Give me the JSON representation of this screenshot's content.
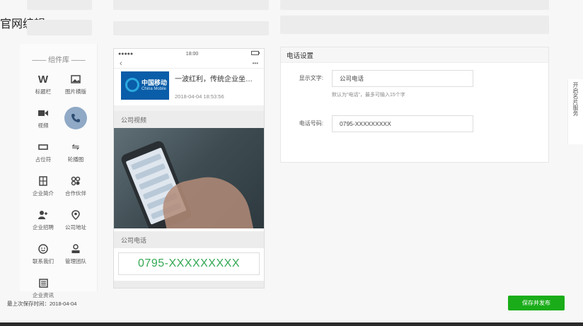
{
  "page": {
    "title": "官网编辑"
  },
  "library": {
    "title": "—— 组件库 ——",
    "items": [
      {
        "label": "标题栏",
        "icon": "title-bar-icon"
      },
      {
        "label": "图片横版",
        "icon": "image-landscape-icon"
      },
      {
        "label": "视频",
        "icon": "video-icon"
      },
      {
        "label": "",
        "icon": "phone-icon",
        "active": true
      },
      {
        "label": "占位符",
        "icon": "placeholder-icon"
      },
      {
        "label": "轮播图",
        "icon": "carousel-icon"
      },
      {
        "label": "企业简介",
        "icon": "company-intro-icon"
      },
      {
        "label": "合作伙伴",
        "icon": "partners-icon"
      },
      {
        "label": "企业招聘",
        "icon": "recruitment-icon"
      },
      {
        "label": "公司地址",
        "icon": "location-icon"
      },
      {
        "label": "联系我们",
        "icon": "contact-icon"
      },
      {
        "label": "管理团队",
        "icon": "team-icon"
      },
      {
        "label": "企业资讯",
        "icon": "news-icon"
      }
    ]
  },
  "phone": {
    "status_carrier": "●●●●●",
    "status_time": "18:00",
    "nav_back": "‹",
    "nav_more": "•••",
    "news": {
      "logo_cn": "中国移动",
      "logo_en": "China Mobile",
      "title": "一波红利，传统企业坐不...",
      "time": "2018-04-04 18:53:56"
    },
    "video_section_title": "公司视频",
    "phone_section_title": "公司电话",
    "phone_number": "0795-XXXXXXXXX"
  },
  "settings": {
    "title": "电话设置",
    "display_text_label": "显示文字:",
    "display_text_value": "公司电话",
    "display_text_hint": "默认为\"电话\"，最多可输入15个字",
    "phone_label": "电话号码:",
    "phone_value": "0795-XXXXXXXXX"
  },
  "side_tab": {
    "label": "开启名片服务"
  },
  "footer": {
    "last_saved": "最上次保存时间：2018-04-04",
    "publish_button": "保存并发布"
  },
  "colors": {
    "accent": "#1aad19",
    "phone_number": "#34a853",
    "active_icon_bg": "#8fa9c6"
  }
}
